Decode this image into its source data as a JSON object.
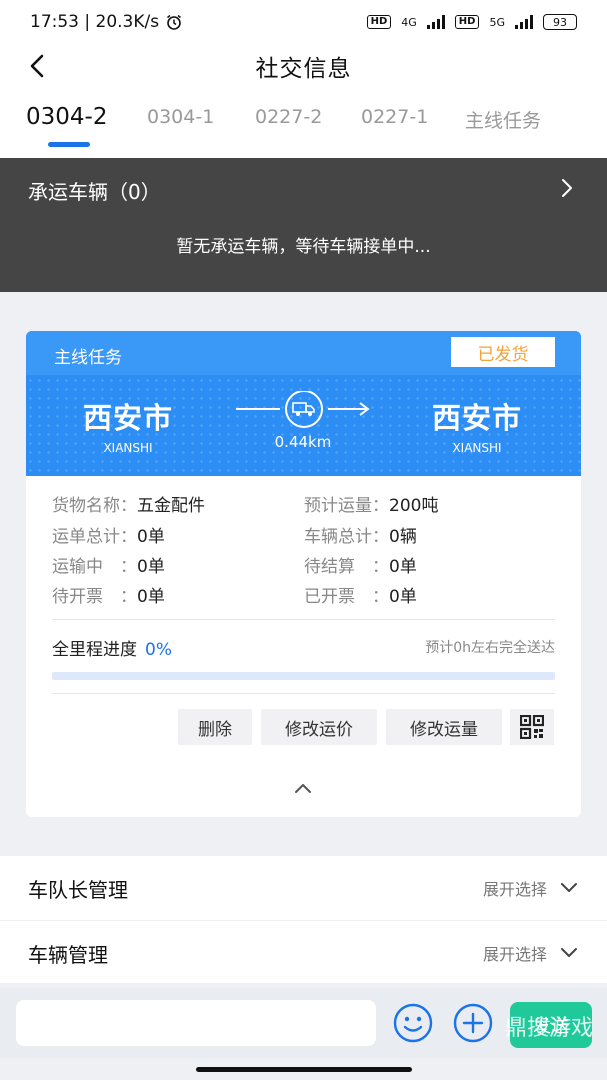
{
  "status_bar": {
    "time_speed": "17:53 | 20.3K/s",
    "net_4g": "4G",
    "net_5g": "5G",
    "hd": "HD",
    "battery": "93"
  },
  "header": {
    "title": "社交信息"
  },
  "tabs": [
    {
      "label": "0304-2",
      "active": true
    },
    {
      "label": "0304-1"
    },
    {
      "label": "0227-2"
    },
    {
      "label": "0227-1"
    },
    {
      "label": "主线任务"
    }
  ],
  "carrier": {
    "title": "承运车辆（0）",
    "empty_text": "暂无承运车辆，等待车辆接单中..."
  },
  "task_card": {
    "label": "主线任务",
    "status": "已发货",
    "origin": {
      "cn": "西安市",
      "en": "XIANSHI"
    },
    "destination": {
      "cn": "西安市",
      "en": "XIANSHI"
    },
    "distance": "0.44km",
    "info": [
      {
        "label": "货物名称：",
        "value": "五金配件"
      },
      {
        "label": "预计运量：",
        "value": "200吨"
      },
      {
        "label": "运单总计：",
        "value": "0单"
      },
      {
        "label": "车辆总计：",
        "value": "0辆"
      },
      {
        "label": "运输中　：",
        "value": "0单"
      },
      {
        "label": "待结算　：",
        "value": "0单"
      },
      {
        "label": "待开票　：",
        "value": "0单"
      },
      {
        "label": "已开票　：",
        "value": "0单"
      }
    ],
    "progress_label": "全里程进度",
    "progress_value": "0%",
    "progress_fraction": 0,
    "eta": "预计0h左右完全送达",
    "buttons": {
      "delete": "删除",
      "edit_price": "修改运价",
      "edit_volume": "修改运量"
    }
  },
  "management": [
    {
      "title": "车队长管理",
      "select": "展开选择"
    },
    {
      "title": "车辆管理",
      "select": "展开选择"
    }
  ],
  "input_bar": {
    "placeholder": "",
    "send_label": "发送",
    "watermark": "鼎搜游戏"
  },
  "colors": {
    "accent": "#1a73e8",
    "card_header": "#2c8ef5",
    "badge_text": "#f2a33a",
    "send_button": "#1fc99a",
    "carrier_bg": "#454545"
  }
}
